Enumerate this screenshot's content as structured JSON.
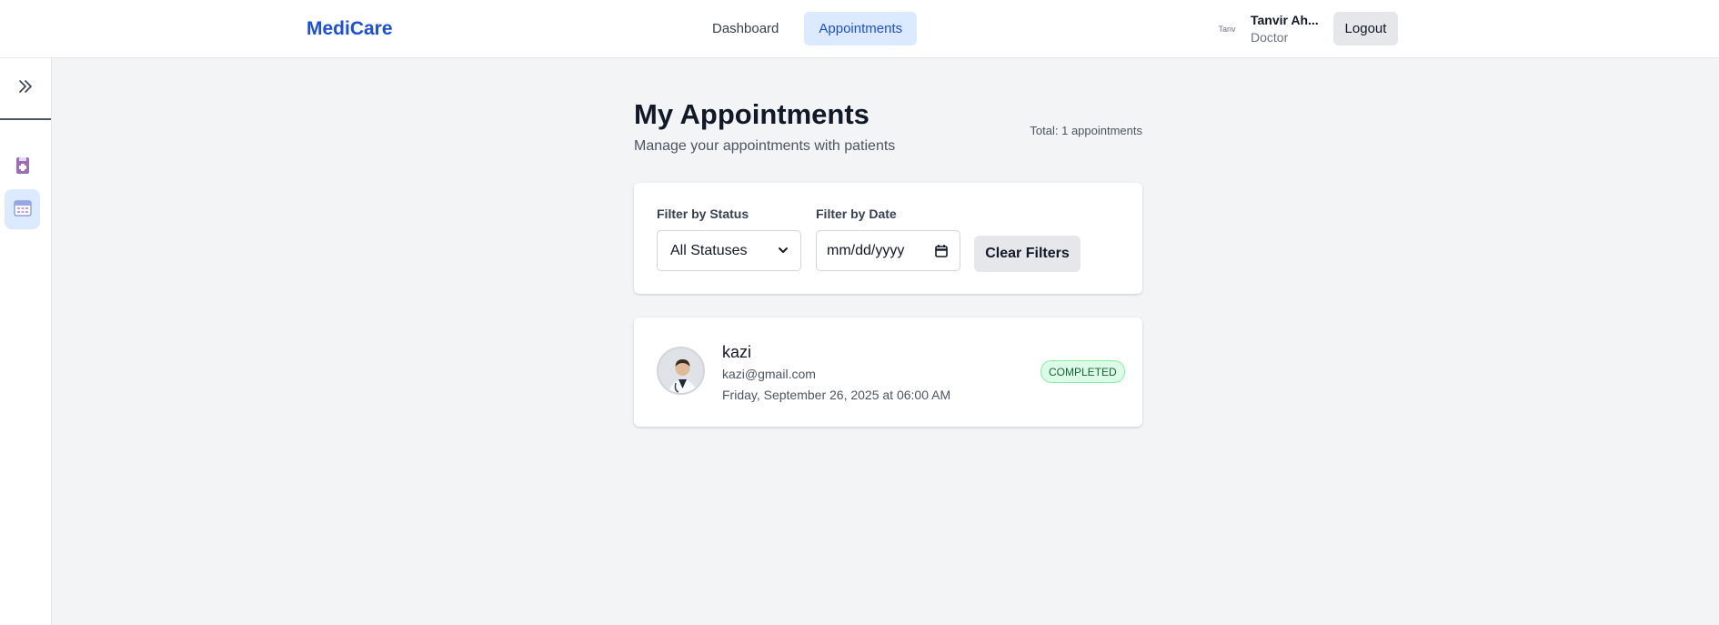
{
  "header": {
    "brand": "MediCare",
    "nav": [
      {
        "label": "Dashboard",
        "active": false
      },
      {
        "label": "Appointments",
        "active": true
      }
    ],
    "user": {
      "name": "Tanvir Ah...",
      "role": "Doctor",
      "avatar_alt": "Tanv"
    },
    "logout_label": "Logout"
  },
  "sidebar": {
    "toggle_icon": "double-chevron-right-icon",
    "items": [
      {
        "icon": "medical-records-icon",
        "active": false
      },
      {
        "icon": "calendar-icon",
        "active": true
      }
    ]
  },
  "page": {
    "title": "My Appointments",
    "subtitle": "Manage your appointments with patients",
    "total": "Total: 1 appointments"
  },
  "filters": {
    "status_label": "Filter by Status",
    "status_value": "All Statuses",
    "date_label": "Filter by Date",
    "date_placeholder": "mm/dd/yyyy",
    "clear_label": "Clear Filters"
  },
  "appointments": [
    {
      "name": "kazi",
      "email": "kazi@gmail.com",
      "datetime": "Friday, September 26, 2025 at 06:00 AM",
      "status": "COMPLETED"
    }
  ],
  "colors": {
    "brand": "#1d4ed8",
    "active_bg": "#dbeafe",
    "status_completed_bg": "#dcfce7",
    "status_completed_text": "#166534"
  }
}
